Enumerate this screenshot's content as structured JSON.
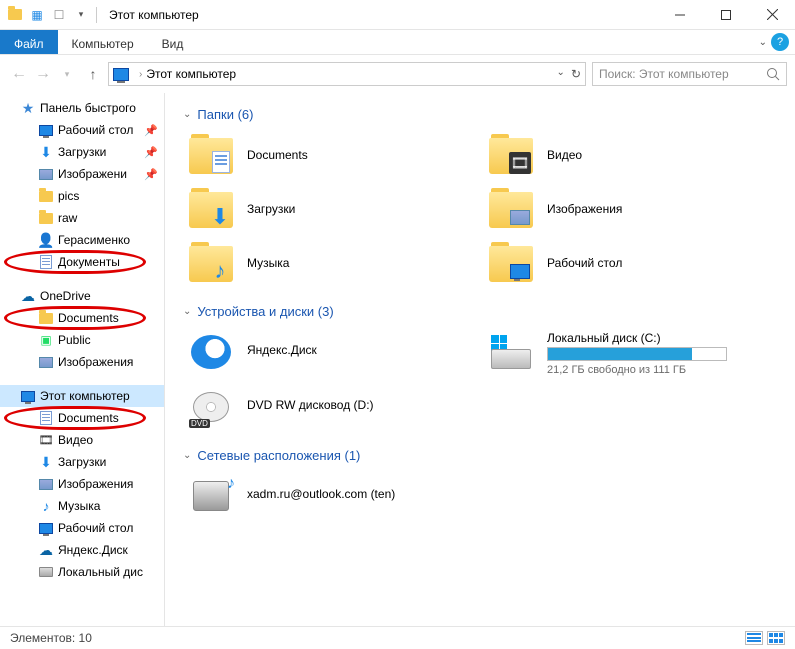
{
  "window": {
    "title": "Этот компьютер"
  },
  "ribbon": {
    "file": "Файл",
    "tab2": "Компьютер",
    "tab3": "Вид"
  },
  "address": {
    "location": "Этот компьютер"
  },
  "search": {
    "placeholder": "Поиск: Этот компьютер"
  },
  "sidebar": {
    "quick": "Панель быстрого",
    "q1": "Рабочий стол",
    "q2": "Загрузки",
    "q3": "Изображени",
    "q4": "pics",
    "q5": "raw",
    "q6": "Герасименко",
    "q7": "Документы",
    "onedrive": "OneDrive",
    "od1": "Documents",
    "od2": "Public",
    "od3": "Изображения",
    "thispc": "Этот компьютер",
    "pc1": "Documents",
    "pc2": "Видео",
    "pc3": "Загрузки",
    "pc4": "Изображения",
    "pc5": "Музыка",
    "pc6": "Рабочий стол",
    "pc7": "Яндекс.Диск",
    "pc8": "Локальный дис"
  },
  "groups": {
    "folders": {
      "title": "Папки (6)",
      "i1": "Documents",
      "i2": "Видео",
      "i3": "Загрузки",
      "i4": "Изображения",
      "i5": "Музыка",
      "i6": "Рабочий стол"
    },
    "drives": {
      "title": "Устройства и диски (3)",
      "yandex": "Яндекс.Диск",
      "local": "Локальный диск (C:)",
      "local_sub": "21,2 ГБ свободно из 111 ГБ",
      "dvd": "DVD RW дисковод (D:)"
    },
    "network": {
      "title": "Сетевые расположения (1)",
      "n1": "xadm.ru@outlook.com (ten)"
    }
  },
  "status": {
    "items": "Элементов: 10"
  }
}
